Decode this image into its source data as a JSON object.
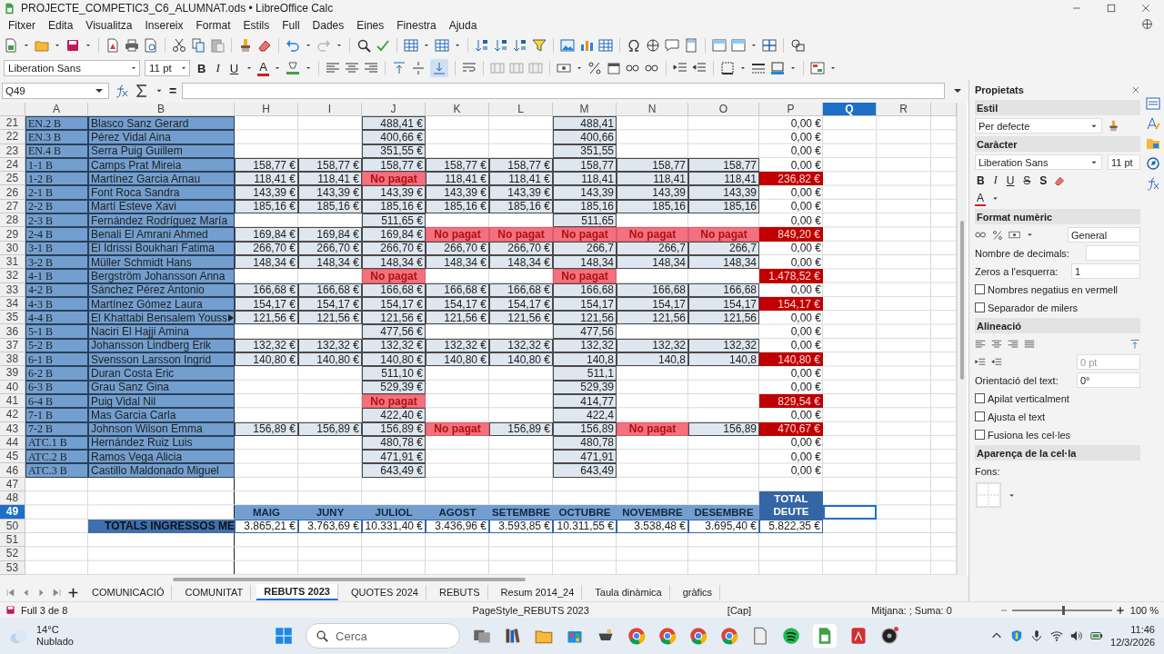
{
  "window": {
    "title": "PROJECTE_COMPETIC3_C6_ALUMNAT.ods • LibreOffice Calc"
  },
  "menu": [
    "Fitxer",
    "Edita",
    "Visualitza",
    "Insereix",
    "Format",
    "Estils",
    "Full",
    "Dades",
    "Eines",
    "Finestra",
    "Ajuda"
  ],
  "toolbar": {
    "font_name": "Liberation Sans",
    "font_size": "11 pt",
    "bold": "B",
    "italic": "I",
    "underline": "U",
    "font_color": "A"
  },
  "formula_bar": {
    "cell_ref": "Q49",
    "equals": "="
  },
  "sheet": {
    "columns": [
      {
        "label": "A",
        "selected": false
      },
      {
        "label": "B",
        "selected": false
      },
      {
        "label": "H",
        "selected": false
      },
      {
        "label": "I",
        "selected": false
      },
      {
        "label": "J",
        "selected": false
      },
      {
        "label": "K",
        "selected": false
      },
      {
        "label": "L",
        "selected": false
      },
      {
        "label": "M",
        "selected": false
      },
      {
        "label": "N",
        "selected": false
      },
      {
        "label": "O",
        "selected": false
      },
      {
        "label": "P",
        "selected": false
      },
      {
        "label": "Q",
        "selected": true
      },
      {
        "label": "R",
        "selected": false
      }
    ],
    "rows": [
      {
        "num": "21",
        "selected": false,
        "kind": "student",
        "a": "EN.2 B",
        "b": "Blasco Sanz Gerard",
        "overflow": false,
        "cells": [
          {
            "kind": "blank"
          },
          {
            "kind": "blank"
          },
          {
            "kind": "amount",
            "text": "488,41 €"
          },
          {
            "kind": "blank"
          },
          {
            "kind": "blank"
          },
          {
            "kind": "amount",
            "text": "488,41"
          },
          {
            "kind": "blank"
          },
          {
            "kind": "blank"
          },
          {
            "kind": "zero",
            "text": "0,00 €"
          }
        ]
      },
      {
        "num": "22",
        "selected": false,
        "kind": "student",
        "a": "EN.3 B",
        "b": "Pérez Vidal Aina",
        "overflow": false,
        "cells": [
          {
            "kind": "blank"
          },
          {
            "kind": "blank"
          },
          {
            "kind": "amount",
            "text": "400,66 €"
          },
          {
            "kind": "blank"
          },
          {
            "kind": "blank"
          },
          {
            "kind": "amount",
            "text": "400,66"
          },
          {
            "kind": "blank"
          },
          {
            "kind": "blank"
          },
          {
            "kind": "zero",
            "text": "0,00 €"
          }
        ]
      },
      {
        "num": "23",
        "selected": false,
        "kind": "student",
        "a": "EN.4 B",
        "b": "Serra Puig Guillem",
        "overflow": false,
        "cells": [
          {
            "kind": "blank"
          },
          {
            "kind": "blank"
          },
          {
            "kind": "amount",
            "text": "351,55 €"
          },
          {
            "kind": "blank"
          },
          {
            "kind": "blank"
          },
          {
            "kind": "amount",
            "text": "351,55"
          },
          {
            "kind": "blank"
          },
          {
            "kind": "blank"
          },
          {
            "kind": "zero",
            "text": "0,00 €"
          }
        ]
      },
      {
        "num": "24",
        "selected": false,
        "kind": "student",
        "a": "1-1 B",
        "b": "Camps Prat Mireia",
        "overflow": false,
        "cells": [
          {
            "kind": "amount",
            "text": "158,77 €"
          },
          {
            "kind": "amount",
            "text": "158,77 €"
          },
          {
            "kind": "amount",
            "text": "158,77 €"
          },
          {
            "kind": "amount",
            "text": "158,77 €"
          },
          {
            "kind": "amount",
            "text": "158,77 €"
          },
          {
            "kind": "amount",
            "text": "158,77"
          },
          {
            "kind": "amount",
            "text": "158,77"
          },
          {
            "kind": "amount",
            "text": "158,77"
          },
          {
            "kind": "zero",
            "text": "0,00 €"
          }
        ]
      },
      {
        "num": "25",
        "selected": false,
        "kind": "student",
        "a": "1-2 B",
        "b": "Martínez Garcia Arnau",
        "overflow": false,
        "cells": [
          {
            "kind": "amount",
            "text": "118,41 €"
          },
          {
            "kind": "amount",
            "text": "118,41 €"
          },
          {
            "kind": "unpaid",
            "text": "No pagat"
          },
          {
            "kind": "amount",
            "text": "118,41 €"
          },
          {
            "kind": "amount",
            "text": "118,41 €"
          },
          {
            "kind": "amount",
            "text": "118,41"
          },
          {
            "kind": "amount",
            "text": "118,41"
          },
          {
            "kind": "amount",
            "text": "118,41"
          },
          {
            "kind": "debt",
            "text": "236,82 €"
          }
        ]
      },
      {
        "num": "26",
        "selected": false,
        "kind": "student",
        "a": "2-1 B",
        "b": "Font Roca Sandra",
        "overflow": false,
        "cells": [
          {
            "kind": "amount",
            "text": "143,39 €"
          },
          {
            "kind": "amount",
            "text": "143,39 €"
          },
          {
            "kind": "amount",
            "text": "143,39 €"
          },
          {
            "kind": "amount",
            "text": "143,39 €"
          },
          {
            "kind": "amount",
            "text": "143,39 €"
          },
          {
            "kind": "amount",
            "text": "143,39"
          },
          {
            "kind": "amount",
            "text": "143,39"
          },
          {
            "kind": "amount",
            "text": "143,39"
          },
          {
            "kind": "zero",
            "text": "0,00 €"
          }
        ]
      },
      {
        "num": "27",
        "selected": false,
        "kind": "student",
        "a": "2-2 B",
        "b": "Martí Esteve Xavi",
        "overflow": false,
        "cells": [
          {
            "kind": "amount",
            "text": "185,16 €"
          },
          {
            "kind": "amount",
            "text": "185,16 €"
          },
          {
            "kind": "amount",
            "text": "185,16 €"
          },
          {
            "kind": "amount",
            "text": "185,16 €"
          },
          {
            "kind": "amount",
            "text": "185,16 €"
          },
          {
            "kind": "amount",
            "text": "185,16"
          },
          {
            "kind": "amount",
            "text": "185,16"
          },
          {
            "kind": "amount",
            "text": "185,16"
          },
          {
            "kind": "zero",
            "text": "0,00 €"
          }
        ]
      },
      {
        "num": "28",
        "selected": false,
        "kind": "student",
        "a": "2-3 B",
        "b": "Fernández Rodríguez María",
        "overflow": false,
        "cells": [
          {
            "kind": "blank"
          },
          {
            "kind": "blank"
          },
          {
            "kind": "amount",
            "text": "511,65 €"
          },
          {
            "kind": "blank"
          },
          {
            "kind": "blank"
          },
          {
            "kind": "amount",
            "text": "511,65"
          },
          {
            "kind": "blank"
          },
          {
            "kind": "blank"
          },
          {
            "kind": "zero",
            "text": "0,00 €"
          }
        ]
      },
      {
        "num": "29",
        "selected": false,
        "kind": "student",
        "a": "2-4 B",
        "b": "Benali El Amrani Ahmed",
        "overflow": false,
        "cells": [
          {
            "kind": "amount",
            "text": "169,84 €"
          },
          {
            "kind": "amount",
            "text": "169,84 €"
          },
          {
            "kind": "amount",
            "text": "169,84 €"
          },
          {
            "kind": "unpaid",
            "text": "No pagat"
          },
          {
            "kind": "unpaid",
            "text": "No pagat"
          },
          {
            "kind": "unpaid",
            "text": "No pagat"
          },
          {
            "kind": "unpaid",
            "text": "No pagat"
          },
          {
            "kind": "unpaid",
            "text": "No pagat"
          },
          {
            "kind": "debt",
            "text": "849,20 €"
          }
        ]
      },
      {
        "num": "30",
        "selected": false,
        "kind": "student",
        "a": "3-1 B",
        "b": "El Idrissi Boukhari Fatima",
        "overflow": false,
        "cells": [
          {
            "kind": "amount",
            "text": "266,70 €"
          },
          {
            "kind": "amount",
            "text": "266,70 €"
          },
          {
            "kind": "amount",
            "text": "266,70 €"
          },
          {
            "kind": "amount",
            "text": "266,70 €"
          },
          {
            "kind": "amount",
            "text": "266,70 €"
          },
          {
            "kind": "amount",
            "text": "266,7"
          },
          {
            "kind": "amount",
            "text": "266,7"
          },
          {
            "kind": "amount",
            "text": "266,7"
          },
          {
            "kind": "zero",
            "text": "0,00 €"
          }
        ]
      },
      {
        "num": "31",
        "selected": false,
        "kind": "student",
        "a": "3-2 B",
        "b": "Müller Schmidt Hans",
        "overflow": false,
        "cells": [
          {
            "kind": "amount",
            "text": "148,34 €"
          },
          {
            "kind": "amount",
            "text": "148,34 €"
          },
          {
            "kind": "amount",
            "text": "148,34 €"
          },
          {
            "kind": "amount",
            "text": "148,34 €"
          },
          {
            "kind": "amount",
            "text": "148,34 €"
          },
          {
            "kind": "amount",
            "text": "148,34"
          },
          {
            "kind": "amount",
            "text": "148,34"
          },
          {
            "kind": "amount",
            "text": "148,34"
          },
          {
            "kind": "zero",
            "text": "0,00 €"
          }
        ]
      },
      {
        "num": "32",
        "selected": false,
        "kind": "student",
        "a": "4-1 B",
        "b": "Bergström Johansson Anna",
        "overflow": false,
        "cells": [
          {
            "kind": "blank"
          },
          {
            "kind": "blank"
          },
          {
            "kind": "unpaid",
            "text": "No pagat"
          },
          {
            "kind": "blank"
          },
          {
            "kind": "blank"
          },
          {
            "kind": "unpaid",
            "text": "No pagat"
          },
          {
            "kind": "blank"
          },
          {
            "kind": "blank"
          },
          {
            "kind": "debt",
            "text": "1.478,52 €"
          }
        ]
      },
      {
        "num": "33",
        "selected": false,
        "kind": "student",
        "a": "4-2 B",
        "b": "Sánchez Pérez Antonio",
        "overflow": false,
        "cells": [
          {
            "kind": "amount",
            "text": "166,68 €"
          },
          {
            "kind": "amount",
            "text": "166,68 €"
          },
          {
            "kind": "amount",
            "text": "166,68 €"
          },
          {
            "kind": "amount",
            "text": "166,68 €"
          },
          {
            "kind": "amount",
            "text": "166,68 €"
          },
          {
            "kind": "amount",
            "text": "166,68"
          },
          {
            "kind": "amount",
            "text": "166,68"
          },
          {
            "kind": "amount",
            "text": "166,68"
          },
          {
            "kind": "zero",
            "text": "0,00 €"
          }
        ]
      },
      {
        "num": "34",
        "selected": false,
        "kind": "student",
        "a": "4-3 B",
        "b": "Martínez Gómez Laura",
        "overflow": false,
        "cells": [
          {
            "kind": "amount",
            "text": "154,17 €"
          },
          {
            "kind": "amount",
            "text": "154,17 €"
          },
          {
            "kind": "amount",
            "text": "154,17 €"
          },
          {
            "kind": "amount",
            "text": "154,17 €"
          },
          {
            "kind": "amount",
            "text": "154,17 €"
          },
          {
            "kind": "amount",
            "text": "154,17"
          },
          {
            "kind": "amount",
            "text": "154,17"
          },
          {
            "kind": "amount",
            "text": "154,17"
          },
          {
            "kind": "debt",
            "text": "154,17 €"
          }
        ]
      },
      {
        "num": "35",
        "selected": false,
        "kind": "student",
        "a": "4-4 B",
        "b": "El Khattabi Bensalem Youss",
        "overflow": true,
        "cells": [
          {
            "kind": "amount",
            "text": "121,56 €"
          },
          {
            "kind": "amount",
            "text": "121,56 €"
          },
          {
            "kind": "amount",
            "text": "121,56 €"
          },
          {
            "kind": "amount",
            "text": "121,56 €"
          },
          {
            "kind": "amount",
            "text": "121,56 €"
          },
          {
            "kind": "amount",
            "text": "121,56"
          },
          {
            "kind": "amount",
            "text": "121,56"
          },
          {
            "kind": "amount",
            "text": "121,56"
          },
          {
            "kind": "zero",
            "text": "0,00 €"
          }
        ]
      },
      {
        "num": "36",
        "selected": false,
        "kind": "student",
        "a": "5-1 B",
        "b": "Naciri El Hajji Amina",
        "overflow": false,
        "cells": [
          {
            "kind": "blank"
          },
          {
            "kind": "blank"
          },
          {
            "kind": "amount",
            "text": "477,56 €"
          },
          {
            "kind": "blank"
          },
          {
            "kind": "blank"
          },
          {
            "kind": "amount",
            "text": "477,56"
          },
          {
            "kind": "blank"
          },
          {
            "kind": "blank"
          },
          {
            "kind": "zero",
            "text": "0,00 €"
          }
        ]
      },
      {
        "num": "37",
        "selected": false,
        "kind": "student",
        "a": "5-2 B",
        "b": "Johansson Lindberg Erik",
        "overflow": false,
        "cells": [
          {
            "kind": "amount",
            "text": "132,32 €"
          },
          {
            "kind": "amount",
            "text": "132,32 €"
          },
          {
            "kind": "amount",
            "text": "132,32 €"
          },
          {
            "kind": "amount",
            "text": "132,32 €"
          },
          {
            "kind": "amount",
            "text": "132,32 €"
          },
          {
            "kind": "amount",
            "text": "132,32"
          },
          {
            "kind": "amount",
            "text": "132,32"
          },
          {
            "kind": "amount",
            "text": "132,32"
          },
          {
            "kind": "zero",
            "text": "0,00 €"
          }
        ]
      },
      {
        "num": "38",
        "selected": false,
        "kind": "student",
        "a": "6-1 B",
        "b": "Svensson Larsson Ingrid",
        "overflow": false,
        "cells": [
          {
            "kind": "amount",
            "text": "140,80 €"
          },
          {
            "kind": "amount",
            "text": "140,80 €"
          },
          {
            "kind": "amount",
            "text": "140,80 €"
          },
          {
            "kind": "amount",
            "text": "140,80 €"
          },
          {
            "kind": "amount",
            "text": "140,80 €"
          },
          {
            "kind": "amount",
            "text": "140,8"
          },
          {
            "kind": "amount",
            "text": "140,8"
          },
          {
            "kind": "amount",
            "text": "140,8"
          },
          {
            "kind": "debt",
            "text": "140,80 €"
          }
        ]
      },
      {
        "num": "39",
        "selected": false,
        "kind": "student",
        "a": "6-2 B",
        "b": "Duran Costa Eric",
        "overflow": false,
        "cells": [
          {
            "kind": "blank"
          },
          {
            "kind": "blank"
          },
          {
            "kind": "amount",
            "text": "511,10 €"
          },
          {
            "kind": "blank"
          },
          {
            "kind": "blank"
          },
          {
            "kind": "amount",
            "text": "511,1"
          },
          {
            "kind": "blank"
          },
          {
            "kind": "blank"
          },
          {
            "kind": "zero",
            "text": "0,00 €"
          }
        ]
      },
      {
        "num": "40",
        "selected": false,
        "kind": "student",
        "a": "6-3 B",
        "b": "Grau Sanz Gina",
        "overflow": false,
        "cells": [
          {
            "kind": "blank"
          },
          {
            "kind": "blank"
          },
          {
            "kind": "amount",
            "text": "529,39 €"
          },
          {
            "kind": "blank"
          },
          {
            "kind": "blank"
          },
          {
            "kind": "amount",
            "text": "529,39"
          },
          {
            "kind": "blank"
          },
          {
            "kind": "blank"
          },
          {
            "kind": "zero",
            "text": "0,00 €"
          }
        ]
      },
      {
        "num": "41",
        "selected": false,
        "kind": "student",
        "a": "6-4 B",
        "b": "Puig Vidal Nil",
        "overflow": false,
        "cells": [
          {
            "kind": "blank"
          },
          {
            "kind": "blank"
          },
          {
            "kind": "unpaid",
            "text": "No pagat"
          },
          {
            "kind": "blank"
          },
          {
            "kind": "blank"
          },
          {
            "kind": "amount",
            "text": "414,77"
          },
          {
            "kind": "blank"
          },
          {
            "kind": "blank"
          },
          {
            "kind": "debt",
            "text": "829,54 €"
          }
        ]
      },
      {
        "num": "42",
        "selected": false,
        "kind": "student",
        "a": "7-1 B",
        "b": "Mas Garcia Carla",
        "overflow": false,
        "cells": [
          {
            "kind": "blank"
          },
          {
            "kind": "blank"
          },
          {
            "kind": "amount",
            "text": "422,40 €"
          },
          {
            "kind": "blank"
          },
          {
            "kind": "blank"
          },
          {
            "kind": "amount",
            "text": "422,4"
          },
          {
            "kind": "blank"
          },
          {
            "kind": "blank"
          },
          {
            "kind": "zero",
            "text": "0,00 €"
          }
        ]
      },
      {
        "num": "43",
        "selected": false,
        "kind": "student",
        "a": "7-2 B",
        "b": "Johnson Wilson Emma",
        "overflow": false,
        "cells": [
          {
            "kind": "amount",
            "text": "156,89 €"
          },
          {
            "kind": "amount",
            "text": "156,89 €"
          },
          {
            "kind": "amount",
            "text": "156,89 €"
          },
          {
            "kind": "unpaid",
            "text": "No pagat"
          },
          {
            "kind": "amount",
            "text": "156,89 €"
          },
          {
            "kind": "amount",
            "text": "156,89"
          },
          {
            "kind": "unpaid",
            "text": "No pagat"
          },
          {
            "kind": "amount",
            "text": "156,89"
          },
          {
            "kind": "debt",
            "text": "470,67 €"
          }
        ]
      },
      {
        "num": "44",
        "selected": false,
        "kind": "student",
        "a": "ATC.1 B",
        "b": "Hernández Ruiz Luis",
        "overflow": false,
        "cells": [
          {
            "kind": "blank"
          },
          {
            "kind": "blank"
          },
          {
            "kind": "amount",
            "text": "480,78 €"
          },
          {
            "kind": "blank"
          },
          {
            "kind": "blank"
          },
          {
            "kind": "amount",
            "text": "480,78"
          },
          {
            "kind": "blank"
          },
          {
            "kind": "blank"
          },
          {
            "kind": "zero",
            "text": "0,00 €"
          }
        ]
      },
      {
        "num": "45",
        "selected": false,
        "kind": "student",
        "a": "ATC.2 B",
        "b": "Ramos Vega Alicia",
        "overflow": false,
        "cells": [
          {
            "kind": "blank"
          },
          {
            "kind": "blank"
          },
          {
            "kind": "amount",
            "text": "471,91 €"
          },
          {
            "kind": "blank"
          },
          {
            "kind": "blank"
          },
          {
            "kind": "amount",
            "text": "471,91"
          },
          {
            "kind": "blank"
          },
          {
            "kind": "blank"
          },
          {
            "kind": "zero",
            "text": "0,00 €"
          }
        ]
      },
      {
        "num": "46",
        "selected": false,
        "kind": "student",
        "a": "ATC.3 B",
        "b": "Castillo Maldonado Miguel",
        "overflow": false,
        "cells": [
          {
            "kind": "blank"
          },
          {
            "kind": "blank"
          },
          {
            "kind": "amount",
            "text": "643,49 €"
          },
          {
            "kind": "blank"
          },
          {
            "kind": "blank"
          },
          {
            "kind": "amount",
            "text": "643,49"
          },
          {
            "kind": "blank"
          },
          {
            "kind": "blank"
          },
          {
            "kind": "zero",
            "text": "0,00 €"
          }
        ]
      },
      {
        "num": "47",
        "selected": false,
        "kind": "blank"
      },
      {
        "num": "48",
        "selected": false,
        "kind": "blank",
        "cells": [
          {
            "kind": "blank"
          },
          {
            "kind": "blank"
          },
          {
            "kind": "blank"
          },
          {
            "kind": "blank"
          },
          {
            "kind": "blank"
          },
          {
            "kind": "blank"
          },
          {
            "kind": "blank"
          },
          {
            "kind": "blank"
          },
          {
            "kind": "tall-header",
            "text": "TOTAL DEUTE"
          }
        ]
      },
      {
        "num": "49",
        "selected": true,
        "kind": "blank",
        "cells": [
          {
            "kind": "month",
            "text": "MAIG"
          },
          {
            "kind": "month",
            "text": "JUNY"
          },
          {
            "kind": "month",
            "text": "JULIOL"
          },
          {
            "kind": "month",
            "text": "AGOST"
          },
          {
            "kind": "month",
            "text": "SETEMBRE"
          },
          {
            "kind": "month",
            "text": "OCTUBRE"
          },
          {
            "kind": "month",
            "text": "NOVEMBRE"
          },
          {
            "kind": "month",
            "text": "DESEMBRE"
          }
        ]
      },
      {
        "num": "50",
        "selected": false,
        "kind": "total",
        "b": "TOTALS INGRESSOS ME",
        "cells": [
          {
            "kind": "total",
            "text": "3.865,21 €"
          },
          {
            "kind": "total",
            "text": "3.763,69 €"
          },
          {
            "kind": "total",
            "text": "10.331,40 €"
          },
          {
            "kind": "total",
            "text": "3.436,96 €"
          },
          {
            "kind": "total",
            "text": "3.593,85 €"
          },
          {
            "kind": "total",
            "text": "10.311,55 €"
          },
          {
            "kind": "total",
            "text": "3.538,48 €"
          },
          {
            "kind": "total",
            "text": "3.695,40 €"
          },
          {
            "kind": "total",
            "text": "5.822,35 €"
          }
        ]
      },
      {
        "num": "51",
        "selected": false,
        "kind": "blank"
      },
      {
        "num": "52",
        "selected": false,
        "kind": "blank"
      },
      {
        "num": "53",
        "selected": false,
        "kind": "blank"
      }
    ]
  },
  "sidebar": {
    "title": "Propietats",
    "style_section": "Estil",
    "style_value": "Per defecte",
    "character_section": "Caràcter",
    "font_name": "Liberation Sans",
    "font_size": "11 pt",
    "format_buttons": [
      "B",
      "I",
      "U",
      "S",
      "S"
    ],
    "font_color": "A",
    "number_section": "Format numèric",
    "number_format": "General",
    "decimals_label": "Nombre de decimals:",
    "zeros_label": "Zeros a l'esquerra:",
    "zeros_value": "1",
    "number_options": [
      {
        "label": "Nombres negatius en vermell",
        "checked": false
      },
      {
        "label": "Separador de milers",
        "checked": false
      }
    ],
    "alignment_section": "Alineació",
    "indent_value": "0 pt",
    "orientation_label": "Orientació del text:",
    "orientation_value": "0°",
    "alignment_options": [
      {
        "label": "Apilat verticalment",
        "checked": false
      },
      {
        "label": "Ajusta el text",
        "checked": false
      },
      {
        "label": "Fusiona les cel·les",
        "checked": false
      }
    ],
    "appearance_section": "Aparença de la cel·la",
    "background_label": "Fons:"
  },
  "sheet_tabs": [
    {
      "label": "COMUNICACIÓ",
      "selected": false
    },
    {
      "label": "COMUNITAT",
      "selected": false
    },
    {
      "label": "REBUTS 2023",
      "selected": true
    },
    {
      "label": "QUOTES 2024",
      "selected": false
    },
    {
      "label": "REBUTS",
      "selected": false
    },
    {
      "label": "Resum 2014_24",
      "selected": false
    },
    {
      "label": "Taula dinàmica",
      "selected": false
    },
    {
      "label": "gràfics",
      "selected": false
    }
  ],
  "status_bar": {
    "sheet": "Full 3 de 8",
    "page_style": "PageStyle_REBUTS 2023",
    "mode": "[Cap]",
    "summary": "Mitjana: ; Suma: 0",
    "zoom": "100 %",
    "zoom_slider": {
      "level": 0.5
    }
  },
  "taskbar": {
    "temperature": "14°C",
    "weather": "Nublado",
    "search_placeholder": "Cerca",
    "time": "11:46",
    "date": "12/3/2026"
  }
}
